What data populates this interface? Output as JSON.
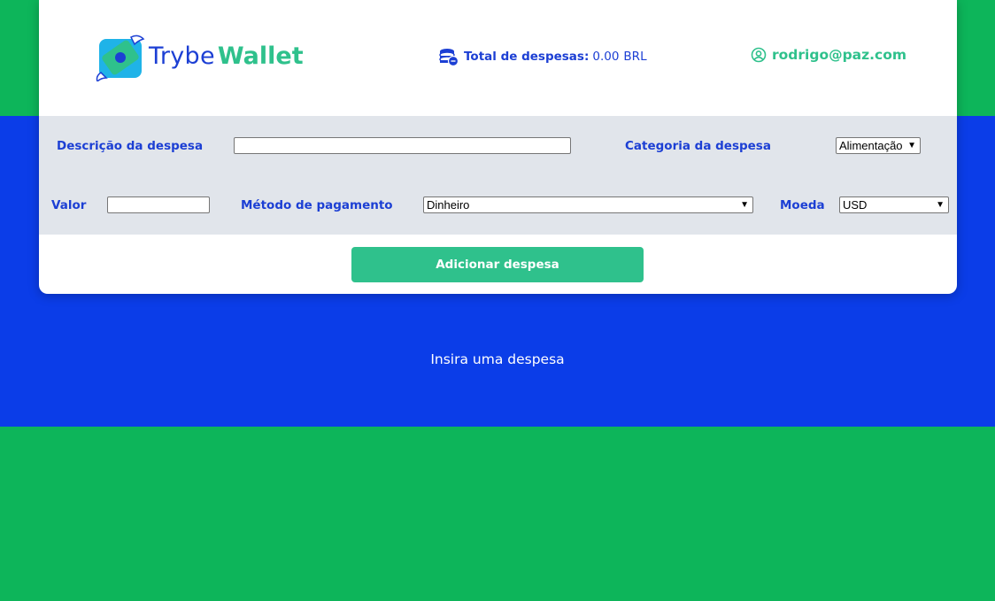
{
  "brand": {
    "name_part1": "Trybe",
    "name_part2": "Wallet"
  },
  "header": {
    "total_label": "Total de despesas:",
    "total_value": "0.00",
    "total_currency": "BRL",
    "user_email": "rodrigo@paz.com"
  },
  "form": {
    "description_label": "Descrição da despesa",
    "description_value": "",
    "category_label": "Categoria da despesa",
    "category_selected": "Alimentação",
    "value_label": "Valor",
    "value_value": "",
    "method_label": "Método de pagamento",
    "method_selected": "Dinheiro",
    "currency_label": "Moeda",
    "currency_selected": "USD",
    "submit_label": "Adicionar despesa"
  },
  "expenses": {
    "empty_message": "Insira uma despesa"
  },
  "colors": {
    "green": "#0db55a",
    "blue": "#0b3de8",
    "accent_green": "#2fc18c",
    "text_blue": "#1c3fd4",
    "form_bg": "#e1e5eb"
  },
  "icons": {
    "logo": "wallet-logo-icon",
    "total": "coins-icon",
    "user": "user-circle-icon",
    "select_caret": "chevron-down-icon"
  }
}
